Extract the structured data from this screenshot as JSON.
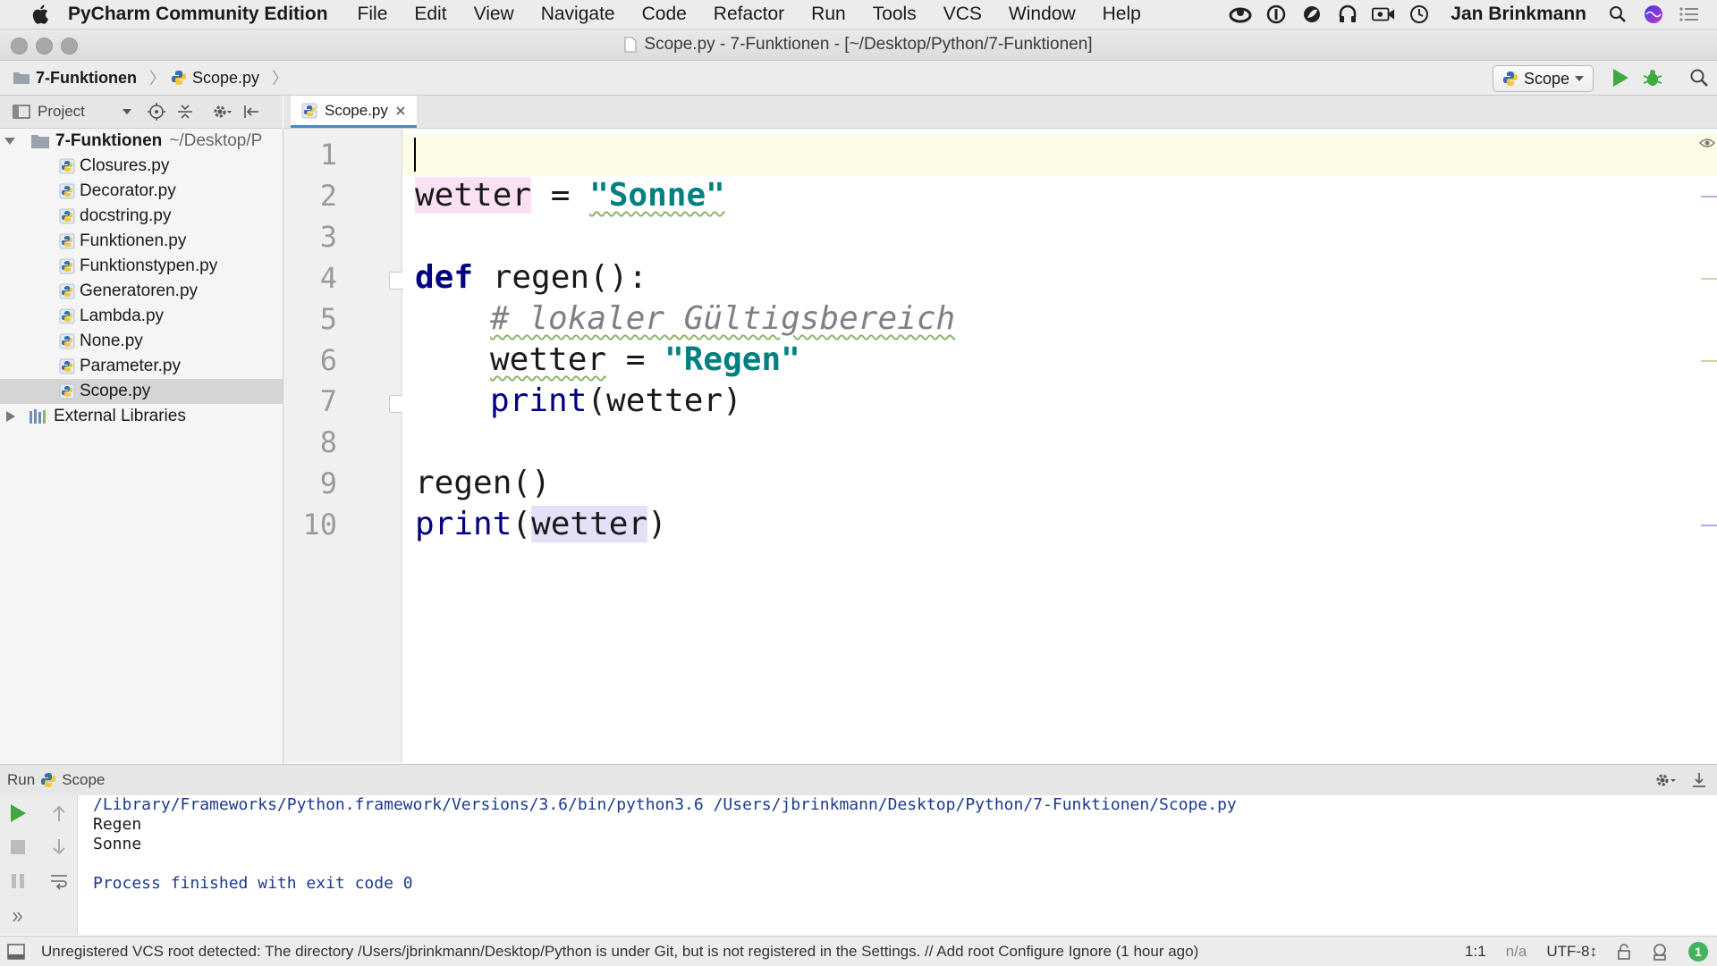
{
  "menubar": {
    "app_name": "PyCharm Community Edition",
    "items": [
      "File",
      "Edit",
      "View",
      "Navigate",
      "Code",
      "Refactor",
      "Run",
      "Tools",
      "VCS",
      "Window",
      "Help"
    ],
    "user_name": "Jan Brinkmann"
  },
  "window": {
    "title": "Scope.py - 7-Funktionen - [~/Desktop/Python/7-Funktionen]"
  },
  "navbar": {
    "breadcrumb": [
      "7-Funktionen",
      "Scope.py"
    ],
    "run_config": "Scope"
  },
  "project_panel": {
    "header_label": "Project",
    "root_name": "7-Funktionen",
    "root_path": "~/Desktop/P",
    "files": [
      "Closures.py",
      "Decorator.py",
      "docstring.py",
      "Funktionen.py",
      "Funktionstypen.py",
      "Generatoren.py",
      "Lambda.py",
      "None.py",
      "Parameter.py",
      "Scope.py"
    ],
    "selected_file": "Scope.py",
    "external_libraries": "External Libraries"
  },
  "editor": {
    "tab_label": "Scope.py",
    "line_numbers": [
      "1",
      "2",
      "3",
      "4",
      "5",
      "6",
      "7",
      "8",
      "9",
      "10"
    ],
    "code": {
      "l2_var": "wetter",
      "l2_op": " = ",
      "l2_str": "\"Sonne\"",
      "l4_kw": "def",
      "l4_rest": " regen():",
      "l5_comment": "# lokaler Gültigsbereich",
      "l6_var": "wetter",
      "l6_op": " = ",
      "l6_str": "\"Regen\"",
      "l7_fn": "print",
      "l7_rest": "(wetter)",
      "l9": "regen()",
      "l10_fn": "print",
      "l10_open": "(",
      "l10_arg": "wetter",
      "l10_close": ")"
    }
  },
  "run_panel": {
    "label": "Run",
    "config_name": "Scope",
    "console_lines": [
      "/Library/Frameworks/Python.framework/Versions/3.6/bin/python3.6 /Users/jbrinkmann/Desktop/Python/7-Funktionen/Scope.py",
      "Regen",
      "Sonne",
      "Process finished with exit code 0"
    ]
  },
  "statusbar": {
    "message": "Unregistered VCS root detected: The directory /Users/jbrinkmann/Desktop/Python is under Git, but is not registered in the Settings. // Add root  Configure  Ignore (1 hour ago)",
    "position": "1:1",
    "na": "n/a",
    "encoding": "UTF-8↕",
    "badge": "1"
  },
  "colors": {
    "keyword": "#000080",
    "string": "#008080",
    "comment": "#808080",
    "run_green": "#3faa3f"
  }
}
